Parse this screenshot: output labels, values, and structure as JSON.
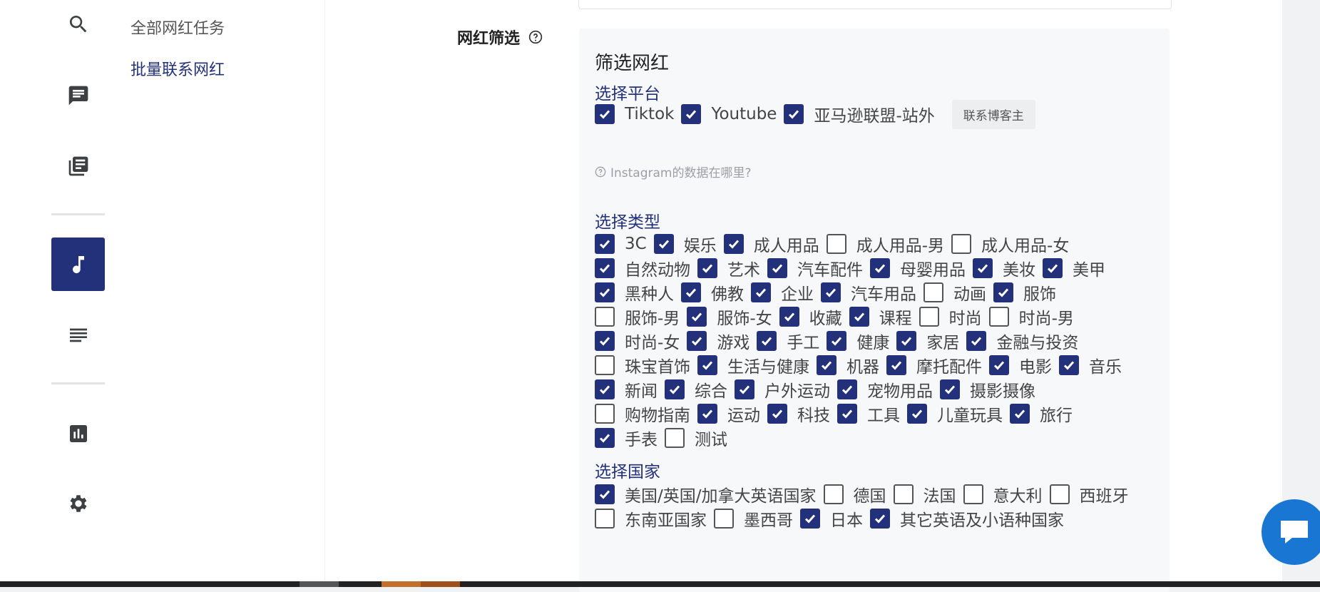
{
  "sidebar": {
    "icons": [
      "search-icon",
      "chat-icon",
      "library-icon",
      "music-note-icon",
      "list-icon",
      "bar-chart-icon",
      "gear-icon"
    ],
    "active_icon": "music-note-icon",
    "accent_color": "#23317a"
  },
  "submenu": {
    "items": [
      {
        "label": "全部网红任务",
        "active": false
      },
      {
        "label": "批量联系网红",
        "active": true
      }
    ]
  },
  "form": {
    "field_label": "网红筛选",
    "box_title": "筛选网红",
    "platform": {
      "title": "选择平台",
      "options": [
        {
          "label": "Tiktok",
          "checked": true
        },
        {
          "label": "Youtube",
          "checked": true
        },
        {
          "label": "亚马逊联盟-站外",
          "checked": true
        }
      ],
      "contact_button": "联系博客主",
      "hint": "Instagram的数据在哪里?"
    },
    "category": {
      "title": "选择类型",
      "rows": [
        [
          {
            "label": "3C",
            "checked": true
          },
          {
            "label": "娱乐",
            "checked": true
          },
          {
            "label": "成人用品",
            "checked": true
          },
          {
            "label": "成人用品-男",
            "checked": false
          },
          {
            "label": "成人用品-女",
            "checked": false
          }
        ],
        [
          {
            "label": "自然动物",
            "checked": true
          },
          {
            "label": "艺术",
            "checked": true
          },
          {
            "label": "汽车配件",
            "checked": true
          },
          {
            "label": "母婴用品",
            "checked": true
          },
          {
            "label": "美妆",
            "checked": true
          },
          {
            "label": "美甲",
            "checked": true
          }
        ],
        [
          {
            "label": "黑种人",
            "checked": true
          },
          {
            "label": "佛教",
            "checked": true
          },
          {
            "label": "企业",
            "checked": true
          },
          {
            "label": "汽车用品",
            "checked": true
          },
          {
            "label": "动画",
            "checked": false
          },
          {
            "label": "服饰",
            "checked": true
          }
        ],
        [
          {
            "label": "服饰-男",
            "checked": false
          },
          {
            "label": "服饰-女",
            "checked": true
          },
          {
            "label": "收藏",
            "checked": true
          },
          {
            "label": "课程",
            "checked": true
          },
          {
            "label": "时尚",
            "checked": false
          },
          {
            "label": "时尚-男",
            "checked": false
          }
        ],
        [
          {
            "label": "时尚-女",
            "checked": true
          },
          {
            "label": "游戏",
            "checked": true
          },
          {
            "label": "手工",
            "checked": true
          },
          {
            "label": "健康",
            "checked": true
          },
          {
            "label": "家居",
            "checked": true
          },
          {
            "label": "金融与投资",
            "checked": true
          }
        ],
        [
          {
            "label": "珠宝首饰",
            "checked": false
          },
          {
            "label": "生活与健康",
            "checked": true
          },
          {
            "label": "机器",
            "checked": true
          },
          {
            "label": "摩托配件",
            "checked": true
          },
          {
            "label": "电影",
            "checked": true
          },
          {
            "label": "音乐",
            "checked": true
          }
        ],
        [
          {
            "label": "新闻",
            "checked": true
          },
          {
            "label": "综合",
            "checked": true
          },
          {
            "label": "户外运动",
            "checked": true
          },
          {
            "label": "宠物用品",
            "checked": true
          },
          {
            "label": "摄影摄像",
            "checked": true
          }
        ],
        [
          {
            "label": "购物指南",
            "checked": false
          },
          {
            "label": "运动",
            "checked": true
          },
          {
            "label": "科技",
            "checked": true
          },
          {
            "label": "工具",
            "checked": true
          },
          {
            "label": "儿童玩具",
            "checked": true
          },
          {
            "label": "旅行",
            "checked": true
          }
        ],
        [
          {
            "label": "手表",
            "checked": true
          },
          {
            "label": "测试",
            "checked": false
          }
        ]
      ]
    },
    "country": {
      "title": "选择国家",
      "rows": [
        [
          {
            "label": "美国/英国/加拿大英语国家",
            "checked": true
          },
          {
            "label": "德国",
            "checked": false
          },
          {
            "label": "法国",
            "checked": false
          },
          {
            "label": "意大利",
            "checked": false
          },
          {
            "label": "西班牙",
            "checked": false
          }
        ],
        [
          {
            "label": "东南亚国家",
            "checked": false
          },
          {
            "label": "墨西哥",
            "checked": false
          },
          {
            "label": "日本",
            "checked": true
          },
          {
            "label": "其它英语及小语种国家",
            "checked": true
          }
        ]
      ]
    }
  },
  "chat_widget": {
    "icon": "chat-bubble-icon",
    "color": "#1976d2"
  }
}
